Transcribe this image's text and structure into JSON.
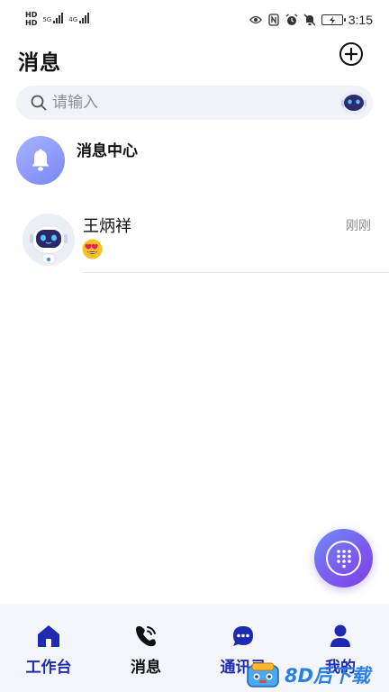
{
  "status_bar": {
    "left_tags": [
      "HD",
      "HD"
    ],
    "network_5g": "5G",
    "network_4g": "4G",
    "time": "3:15"
  },
  "header": {
    "title": "消息",
    "add_icon": "plus-circle-icon"
  },
  "search": {
    "placeholder": "请输入",
    "icon": "search-icon",
    "assistant_icon": "robot-icon"
  },
  "notification_center": {
    "title": "消息中心",
    "icon": "bell-icon",
    "accent": "#8b96f8"
  },
  "conversations": [
    {
      "name": "王炳祥",
      "time": "刚刚",
      "preview_emoji": "😍",
      "avatar_icon": "robot-avatar"
    }
  ],
  "fab": {
    "icon": "dialpad-icon",
    "gradient": [
      "#6b8df6",
      "#7a3fe6"
    ]
  },
  "bottom_nav": {
    "items": [
      {
        "label": "工作台",
        "icon": "home-icon",
        "active": true
      },
      {
        "label": "消息",
        "icon": "phone-call-icon",
        "active": false
      },
      {
        "label": "通讯录",
        "icon": "chat-bubble-icon",
        "active": false
      },
      {
        "label": "我的",
        "icon": "user-icon",
        "active": false
      }
    ],
    "accent": "#1e2ab0"
  },
  "watermark": {
    "text": "8D后下载"
  }
}
